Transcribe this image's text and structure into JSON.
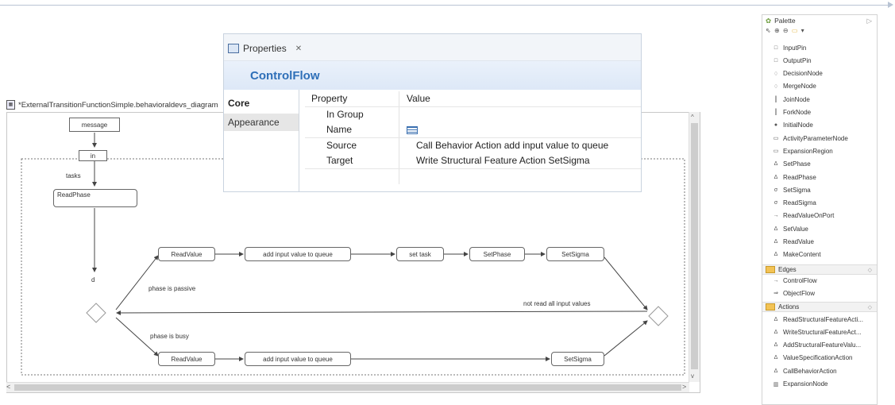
{
  "editor": {
    "tab_title": "*ExternalTransitionFunctionSimple.behavioraldevs_diagram"
  },
  "diagram": {
    "nodes": {
      "message": "message",
      "in": "in",
      "tasks": "tasks",
      "readphase": "ReadPhase",
      "d": "d",
      "readvalue_top": "ReadValue",
      "add_input_top": "add input value to queue",
      "set_task": "set task",
      "setphase": "SetPhase",
      "setsigma_top": "SetSigma",
      "readvalue_bottom": "ReadValue",
      "add_input_bottom": "add input value to queue",
      "setsigma_bottom": "SetSigma"
    },
    "guards": {
      "passive": "phase is passive",
      "busy": "phase is busy",
      "not_read_all": "not read all input values"
    }
  },
  "properties": {
    "tab_label": "Properties",
    "tab_close": "✕",
    "title": "ControlFlow",
    "sections": [
      "Core",
      "Appearance"
    ],
    "header": {
      "property": "Property",
      "value": "Value"
    },
    "rows": [
      {
        "property": "In Group",
        "value": ""
      },
      {
        "property": "Name",
        "value": ""
      },
      {
        "property": "Source",
        "value": "Call Behavior Action add input value to queue"
      },
      {
        "property": "Target",
        "value": "Write Structural Feature Action SetSigma"
      }
    ]
  },
  "palette": {
    "title": "Palette",
    "nodes": [
      {
        "label": "InputPin",
        "icon": "□"
      },
      {
        "label": "OutputPin",
        "icon": "□"
      },
      {
        "label": "DecisionNode",
        "icon": "♢"
      },
      {
        "label": "MergeNode",
        "icon": "♢"
      },
      {
        "label": "JoinNode",
        "icon": "║"
      },
      {
        "label": "ForkNode",
        "icon": "║"
      },
      {
        "label": "InitialNode",
        "icon": "●"
      },
      {
        "label": "ActivityParameterNode",
        "icon": "▭"
      },
      {
        "label": "ExpansionRegion",
        "icon": "▭"
      },
      {
        "label": "SetPhase",
        "icon": "Δ"
      },
      {
        "label": "ReadPhase",
        "icon": "Δ"
      },
      {
        "label": "SetSigma",
        "icon": "σ"
      },
      {
        "label": "ReadSigma",
        "icon": "σ"
      },
      {
        "label": "ReadValueOnPort",
        "icon": "→"
      },
      {
        "label": "SetValue",
        "icon": "Δ"
      },
      {
        "label": "ReadValue",
        "icon": "Δ"
      },
      {
        "label": "MakeContent",
        "icon": "Δ"
      }
    ],
    "edges_drawer": "Edges",
    "edges": [
      {
        "label": "ControlFlow",
        "icon": "→"
      },
      {
        "label": "ObjectFlow",
        "icon": "⇒"
      }
    ],
    "actions_drawer": "Actions",
    "actions": [
      {
        "label": "ReadStructuralFeatureActi...",
        "icon": "Δ"
      },
      {
        "label": "WriteStructuralFeatureAct...",
        "icon": "Δ"
      },
      {
        "label": "AddStructuralFeatureValu...",
        "icon": "Δ"
      },
      {
        "label": "ValueSpecificationAction",
        "icon": "Δ"
      },
      {
        "label": "CallBehaviorAction",
        "icon": "Δ"
      },
      {
        "label": "ExpansionNode",
        "icon": "▥"
      }
    ]
  }
}
